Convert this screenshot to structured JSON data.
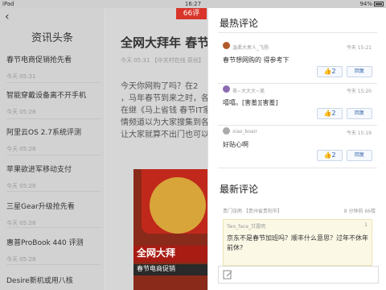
{
  "status": {
    "left": "iPad",
    "time": "16:27",
    "battery": "94%"
  },
  "sidebar": {
    "title": "资讯头条",
    "items": [
      {
        "label": "春节电商促销抢先看",
        "time": "今天 05:31"
      },
      {
        "label": "智能穿戴设备离不开手机",
        "time": "今天 05:28"
      },
      {
        "label": "阿里云OS 2.7系统评测",
        "time": "今天 05:28"
      },
      {
        "label": "苹果欲进军移动支付",
        "time": "今天 05:28"
      },
      {
        "label": "三星Gear升级抢先看",
        "time": "今天 05:28"
      },
      {
        "label": "惠普ProBook 440 评测",
        "time": "今天 05:28"
      },
      {
        "label": "Desire新机或用八核",
        "time": ""
      }
    ]
  },
  "article": {
    "title": "全网大拜年 春节",
    "meta": "今天 05:31  【中关村在线 原创】",
    "body": [
      "今天你网购了吗？在2",
      "，马年春节到来之时，各大",
      "情频道以为大家搜集到各大",
      "让大家就算不出门也可以轻"
    ],
    "body_partial": "在继《马上省钱 春节IT家",
    "comment_count": "66评",
    "photo_text_1": "全网大拜",
    "photo_text_2": "春节电商促销"
  },
  "comments_panel": {
    "hot_title": "最热评论",
    "hot": [
      {
        "user": "温柔大男人_飞扬",
        "time": "今天 15:21",
        "text": "春节想网购的 得参考下",
        "likes": "2",
        "reply": "回复"
      },
      {
        "user": "茶~大大大~美",
        "time": "今天 15:20",
        "text": "嘻嘻。[害羞][害羞]",
        "likes": "2",
        "reply": "回复"
      },
      {
        "user": "xiao_boair",
        "time": "今天 15:19",
        "text": "好贴心啊",
        "likes": "2",
        "reply": "回复"
      }
    ],
    "latest_title": "最新评论",
    "latest": {
      "meta_left": "贵门张雨  【贵州省贵阳市】",
      "meta_right": "8 分钟前  66楼",
      "quote_user": "Two_face_甘露明",
      "quote_num": "1",
      "quote_text": "京东不是春节加班吗？顺丰什么意思？过年不休年前休?"
    }
  }
}
